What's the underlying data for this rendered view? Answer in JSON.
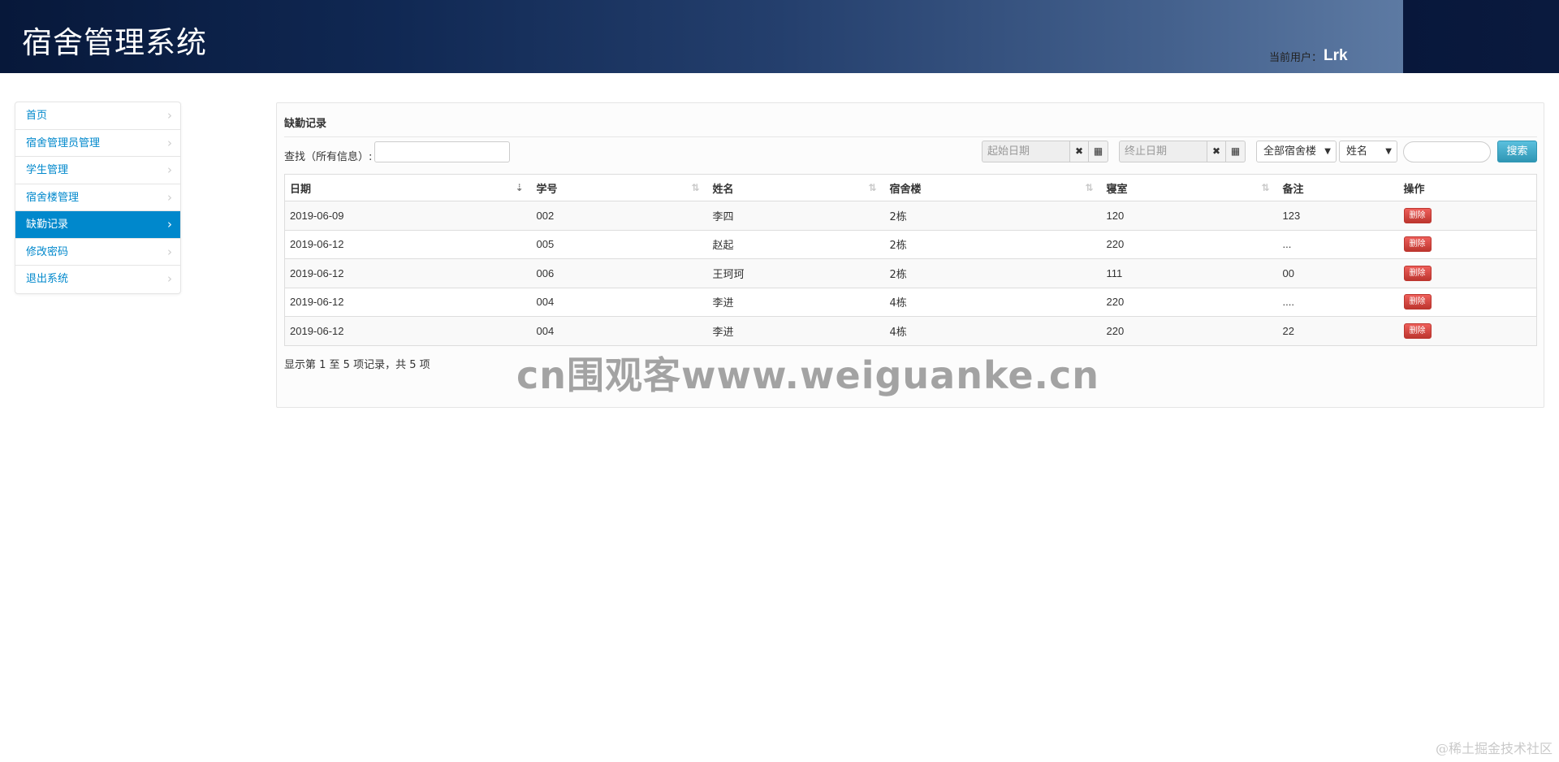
{
  "header": {
    "brand": "宿舍管理系统",
    "user_label": "当前用户：",
    "user_name": "Lrk"
  },
  "sidebar": {
    "items": [
      {
        "label": "首页",
        "active": false
      },
      {
        "label": "宿舍管理员管理",
        "active": false
      },
      {
        "label": "学生管理",
        "active": false
      },
      {
        "label": "宿舍楼管理",
        "active": false
      },
      {
        "label": "缺勤记录",
        "active": true
      },
      {
        "label": "修改密码",
        "active": false
      },
      {
        "label": "退出系统",
        "active": false
      }
    ],
    "chevron_icon": "chevron-right-icon"
  },
  "panel": {
    "title": "缺勤记录",
    "search_label": "查找（所有信息）:",
    "search_value": "",
    "start_date_placeholder": "起始日期",
    "end_date_placeholder": "终止日期",
    "clear_icon": "✖",
    "calendar_icon": "calendar-grid-icon",
    "building_select": "全部宿舍楼",
    "field_select": "姓名",
    "keyword_value": "",
    "search_button": "搜索"
  },
  "table": {
    "columns": [
      "日期",
      "学号",
      "姓名",
      "宿舍楼",
      "寝室",
      "备注",
      "操作"
    ],
    "rows": [
      [
        "2019-06-09",
        "002",
        "李四",
        "2栋",
        "120",
        "123"
      ],
      [
        "2019-06-12",
        "005",
        "赵起",
        "2栋",
        "220",
        "..."
      ],
      [
        "2019-06-12",
        "006",
        "王珂珂",
        "2栋",
        "111",
        "00"
      ],
      [
        "2019-06-12",
        "004",
        "李进",
        "4栋",
        "220",
        "...."
      ],
      [
        "2019-06-12",
        "004",
        "李进",
        "4栋",
        "220",
        "22"
      ]
    ],
    "delete_label": "删除",
    "info": "显示第 1 至 5 项记录，共 5 项"
  },
  "watermark": "cn围观客www.weiguanke.cn",
  "credit": "@稀土掘金技术社区",
  "colors": {
    "accent": "#0088cc",
    "search_btn": "#49afcd",
    "danger": "#da4f49"
  }
}
